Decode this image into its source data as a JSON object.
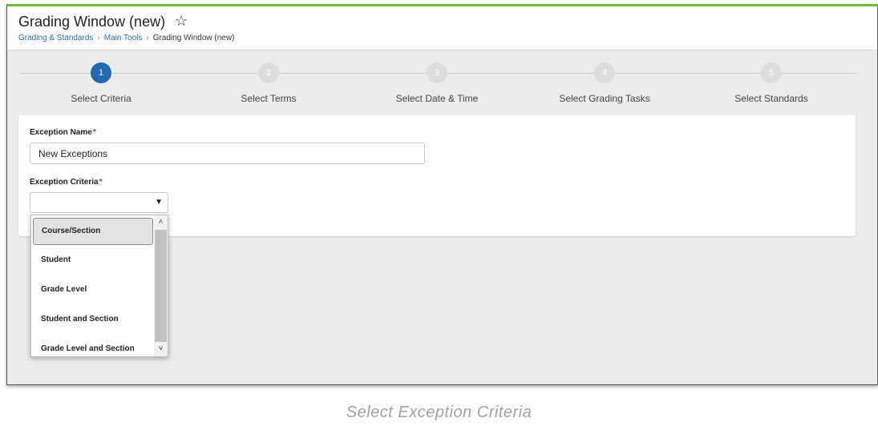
{
  "header": {
    "title": "Grading Window (new)",
    "star_icon": "☆",
    "breadcrumb": [
      "Grading & Standards",
      "Main Tools",
      "Grading Window (new)"
    ],
    "breadcrumb_sep": "›"
  },
  "stepper": {
    "steps": [
      {
        "number": "1",
        "label": "Select Criteria",
        "active": true
      },
      {
        "number": "2",
        "label": "Select Terms",
        "active": false
      },
      {
        "number": "3",
        "label": "Select Date & Time",
        "active": false
      },
      {
        "number": "4",
        "label": "Select Grading Tasks",
        "active": false
      },
      {
        "number": "5",
        "label": "Select Standards",
        "active": false
      }
    ]
  },
  "form": {
    "exception_name_label": "Exception Name",
    "exception_name_value": "New Exceptions",
    "exception_criteria_label": "Exception Criteria",
    "exception_criteria_value": "",
    "required_mark": "*",
    "select_arrow": "▼",
    "options": [
      "Course/Section",
      "Student",
      "Grade Level",
      "Student and Section",
      "Grade Level and Section"
    ],
    "highlighted_option": "Course/Section",
    "scroll_up": "˄",
    "scroll_down": "˅"
  },
  "caption": "Select Exception Criteria",
  "colors": {
    "active_step": "#2468b2",
    "inactive_step": "#dddddd",
    "accent_border": "#6bbf3a",
    "link": "#2b6aa8",
    "required": "#d32f2f"
  }
}
